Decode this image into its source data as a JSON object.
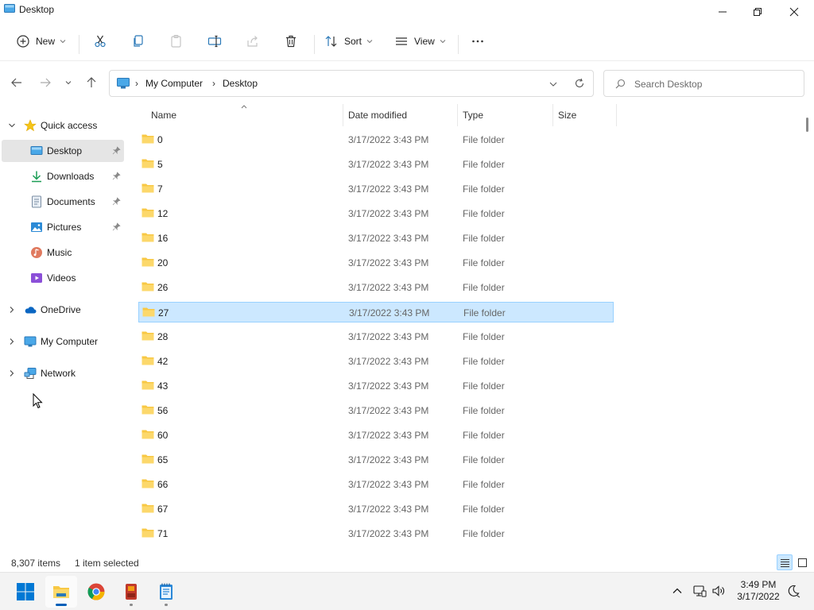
{
  "window": {
    "title": "Desktop"
  },
  "commandbar": {
    "new_label": "New",
    "sort_label": "Sort",
    "view_label": "View"
  },
  "addressbar": {
    "crumbs": [
      "My Computer",
      "Desktop"
    ]
  },
  "search": {
    "placeholder": "Search Desktop"
  },
  "sidebar": {
    "quick_access": "Quick access",
    "items": [
      {
        "label": "Desktop",
        "icon": "desktop-icon",
        "pinned": true
      },
      {
        "label": "Downloads",
        "icon": "download-icon",
        "pinned": true
      },
      {
        "label": "Documents",
        "icon": "document-icon",
        "pinned": true
      },
      {
        "label": "Pictures",
        "icon": "pictures-icon",
        "pinned": true
      },
      {
        "label": "Music",
        "icon": "music-icon",
        "pinned": false
      },
      {
        "label": "Videos",
        "icon": "videos-icon",
        "pinned": false
      }
    ],
    "onedrive": "OneDrive",
    "my_computer": "My Computer",
    "network": "Network"
  },
  "columns": {
    "name": "Name",
    "date": "Date modified",
    "type": "Type",
    "size": "Size"
  },
  "files": [
    {
      "name": "0",
      "date": "3/17/2022 3:43 PM",
      "type": "File folder"
    },
    {
      "name": "5",
      "date": "3/17/2022 3:43 PM",
      "type": "File folder"
    },
    {
      "name": "7",
      "date": "3/17/2022 3:43 PM",
      "type": "File folder"
    },
    {
      "name": "12",
      "date": "3/17/2022 3:43 PM",
      "type": "File folder"
    },
    {
      "name": "16",
      "date": "3/17/2022 3:43 PM",
      "type": "File folder"
    },
    {
      "name": "20",
      "date": "3/17/2022 3:43 PM",
      "type": "File folder"
    },
    {
      "name": "26",
      "date": "3/17/2022 3:43 PM",
      "type": "File folder"
    },
    {
      "name": "27",
      "date": "3/17/2022 3:43 PM",
      "type": "File folder",
      "selected": true
    },
    {
      "name": "28",
      "date": "3/17/2022 3:43 PM",
      "type": "File folder"
    },
    {
      "name": "42",
      "date": "3/17/2022 3:43 PM",
      "type": "File folder"
    },
    {
      "name": "43",
      "date": "3/17/2022 3:43 PM",
      "type": "File folder"
    },
    {
      "name": "56",
      "date": "3/17/2022 3:43 PM",
      "type": "File folder"
    },
    {
      "name": "60",
      "date": "3/17/2022 3:43 PM",
      "type": "File folder"
    },
    {
      "name": "65",
      "date": "3/17/2022 3:43 PM",
      "type": "File folder"
    },
    {
      "name": "66",
      "date": "3/17/2022 3:43 PM",
      "type": "File folder"
    },
    {
      "name": "67",
      "date": "3/17/2022 3:43 PM",
      "type": "File folder"
    },
    {
      "name": "71",
      "date": "3/17/2022 3:43 PM",
      "type": "File folder"
    }
  ],
  "status": {
    "item_count": "8,307 items",
    "selection": "1 item selected"
  },
  "taskbar": {
    "time": "3:49 PM",
    "date": "3/17/2022"
  },
  "colors": {
    "accent": "#005fb8",
    "selection_bg": "#cce8ff",
    "selection_border": "#99d1ff",
    "folder_yellow": "#f8c844"
  }
}
